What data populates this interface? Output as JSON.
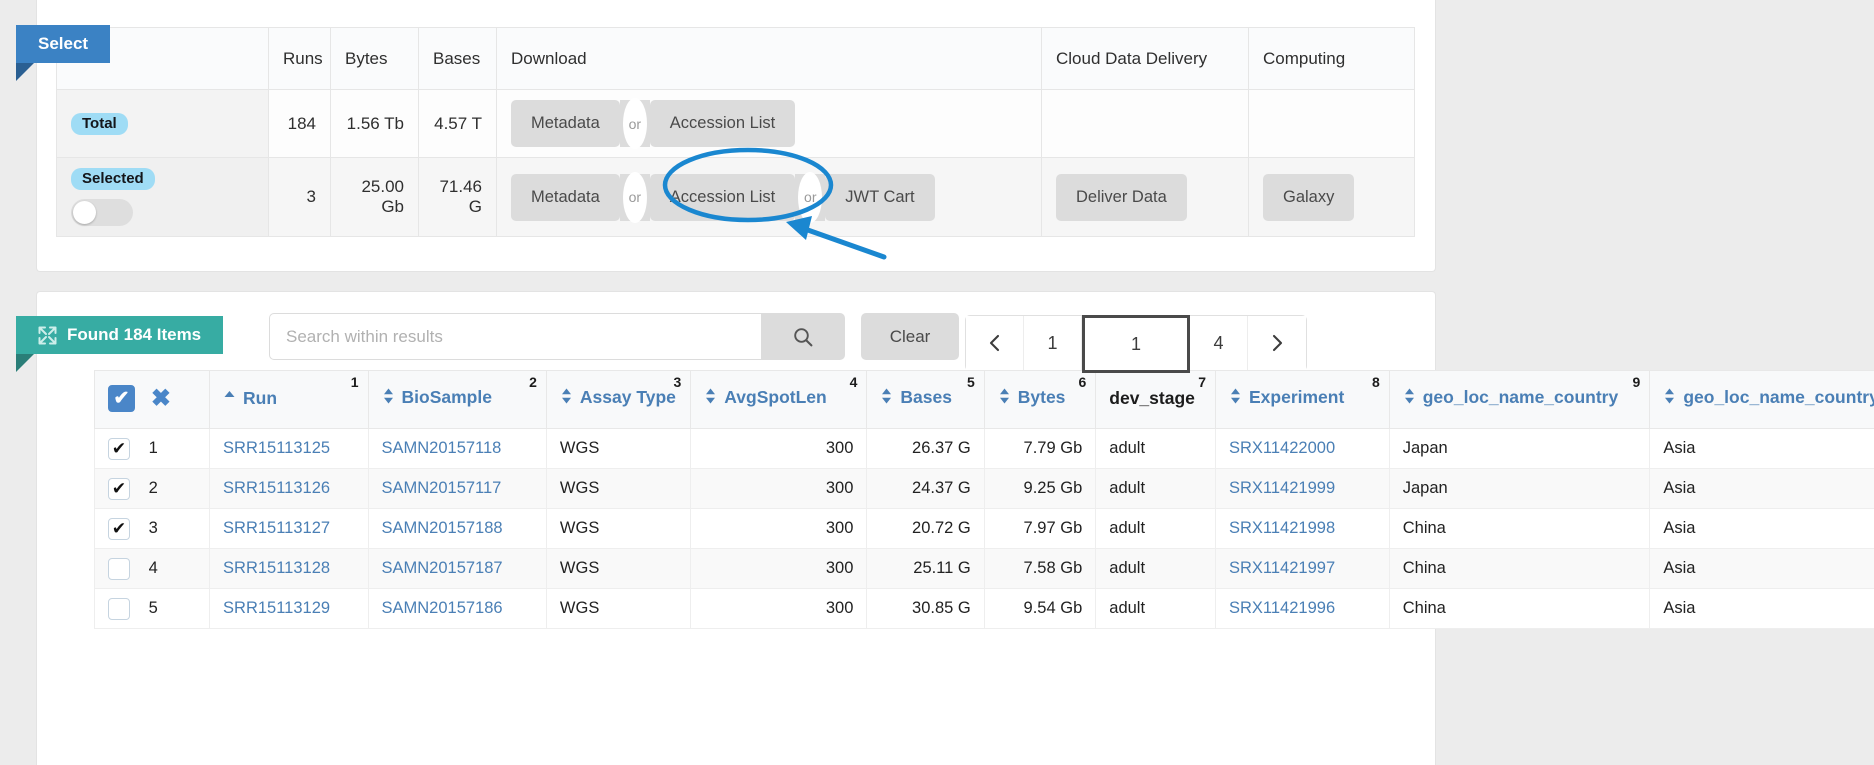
{
  "tabs": {
    "select_label": "Select",
    "found_label": "Found 184 Items",
    "found_icon": "expand-arrows-icon"
  },
  "summary": {
    "headers": {
      "label": "",
      "runs": "Runs",
      "bytes": "Bytes",
      "bases": "Bases",
      "download": "Download",
      "cloud": "Cloud Data Delivery",
      "computing": "Computing"
    },
    "rows": [
      {
        "label": "Total",
        "runs": "184",
        "bytes": "1.56 Tb",
        "bases": "4.57 T",
        "download_buttons": [
          "Metadata",
          "Accession List"
        ],
        "or_label": "or",
        "cloud": "",
        "computing": ""
      },
      {
        "label": "Selected",
        "runs": "3",
        "bytes": "25.00 Gb",
        "bases": "71.46 G",
        "download_buttons": [
          "Metadata",
          "Accession List",
          "JWT Cart"
        ],
        "or_label": "or",
        "cloud": "Deliver Data",
        "computing": "Galaxy"
      }
    ]
  },
  "search": {
    "value": "",
    "placeholder": "Search within results",
    "search_icon": "search-icon",
    "clear_label": "Clear"
  },
  "pagination": {
    "prev_icon": "chevron-left-icon",
    "next_icon": "chevron-right-icon",
    "first_page": "1",
    "current_page": "1",
    "last_page": "4"
  },
  "table": {
    "select_all_icon": "checkbox-checked-icon",
    "clear_all_icon": "x-mark-icon",
    "columns": [
      {
        "label": "Run",
        "num": "1",
        "sort": "asc",
        "sortable": true,
        "align": "left"
      },
      {
        "label": "BioSample",
        "num": "2",
        "sort": "both",
        "sortable": true,
        "align": "left"
      },
      {
        "label": "Assay Type",
        "num": "3",
        "sort": "both",
        "sortable": true,
        "align": "left"
      },
      {
        "label": "AvgSpotLen",
        "num": "4",
        "sort": "both",
        "sortable": true,
        "align": "right"
      },
      {
        "label": "Bases",
        "num": "5",
        "sort": "both",
        "sortable": true,
        "align": "right"
      },
      {
        "label": "Bytes",
        "num": "6",
        "sort": "both",
        "sortable": true,
        "align": "right"
      },
      {
        "label": "dev_stage",
        "num": "7",
        "sort": "none",
        "sortable": false,
        "align": "left"
      },
      {
        "label": "Experiment",
        "num": "8",
        "sort": "both",
        "sortable": true,
        "align": "left"
      },
      {
        "label": "geo_loc_name_country",
        "num": "9",
        "sort": "both",
        "sortable": true,
        "align": "left"
      },
      {
        "label": "geo_loc_name_country_continent",
        "num": "",
        "sort": "both",
        "sortable": true,
        "align": "left"
      }
    ],
    "rows": [
      {
        "checked": true,
        "n": "1",
        "run": "SRR15113125",
        "biosample": "SAMN20157118",
        "assay": "WGS",
        "avgspotlen": "300",
        "bases": "26.37 G",
        "bytes": "7.79 Gb",
        "dev_stage": "adult",
        "experiment": "SRX11422000",
        "country": "Japan",
        "continent": "Asia"
      },
      {
        "checked": true,
        "n": "2",
        "run": "SRR15113126",
        "biosample": "SAMN20157117",
        "assay": "WGS",
        "avgspotlen": "300",
        "bases": "24.37 G",
        "bytes": "9.25 Gb",
        "dev_stage": "adult",
        "experiment": "SRX11421999",
        "country": "Japan",
        "continent": "Asia"
      },
      {
        "checked": true,
        "n": "3",
        "run": "SRR15113127",
        "biosample": "SAMN20157188",
        "assay": "WGS",
        "avgspotlen": "300",
        "bases": "20.72 G",
        "bytes": "7.97 Gb",
        "dev_stage": "adult",
        "experiment": "SRX11421998",
        "country": "China",
        "continent": "Asia"
      },
      {
        "checked": false,
        "n": "4",
        "run": "SRR15113128",
        "biosample": "SAMN20157187",
        "assay": "WGS",
        "avgspotlen": "300",
        "bases": "25.11 G",
        "bytes": "7.58 Gb",
        "dev_stage": "adult",
        "experiment": "SRX11421997",
        "country": "China",
        "continent": "Asia"
      },
      {
        "checked": false,
        "n": "5",
        "run": "SRR15113129",
        "biosample": "SAMN20157186",
        "assay": "WGS",
        "avgspotlen": "300",
        "bases": "30.85 G",
        "bytes": "9.54 Gb",
        "dev_stage": "adult",
        "experiment": "SRX11421996",
        "country": "China",
        "continent": "Asia"
      }
    ]
  },
  "annotation": {
    "ellipse_target": "Accession List",
    "arrow": "pointer-arrow",
    "color": "#1a87d0"
  },
  "colors": {
    "select_tab": "#3b82c4",
    "found_tab": "#37aca3",
    "pill": "#9fdcf5",
    "link": "#4a7fb5",
    "button_gray": "#dcdcdc",
    "annotation": "#1a87d0"
  }
}
